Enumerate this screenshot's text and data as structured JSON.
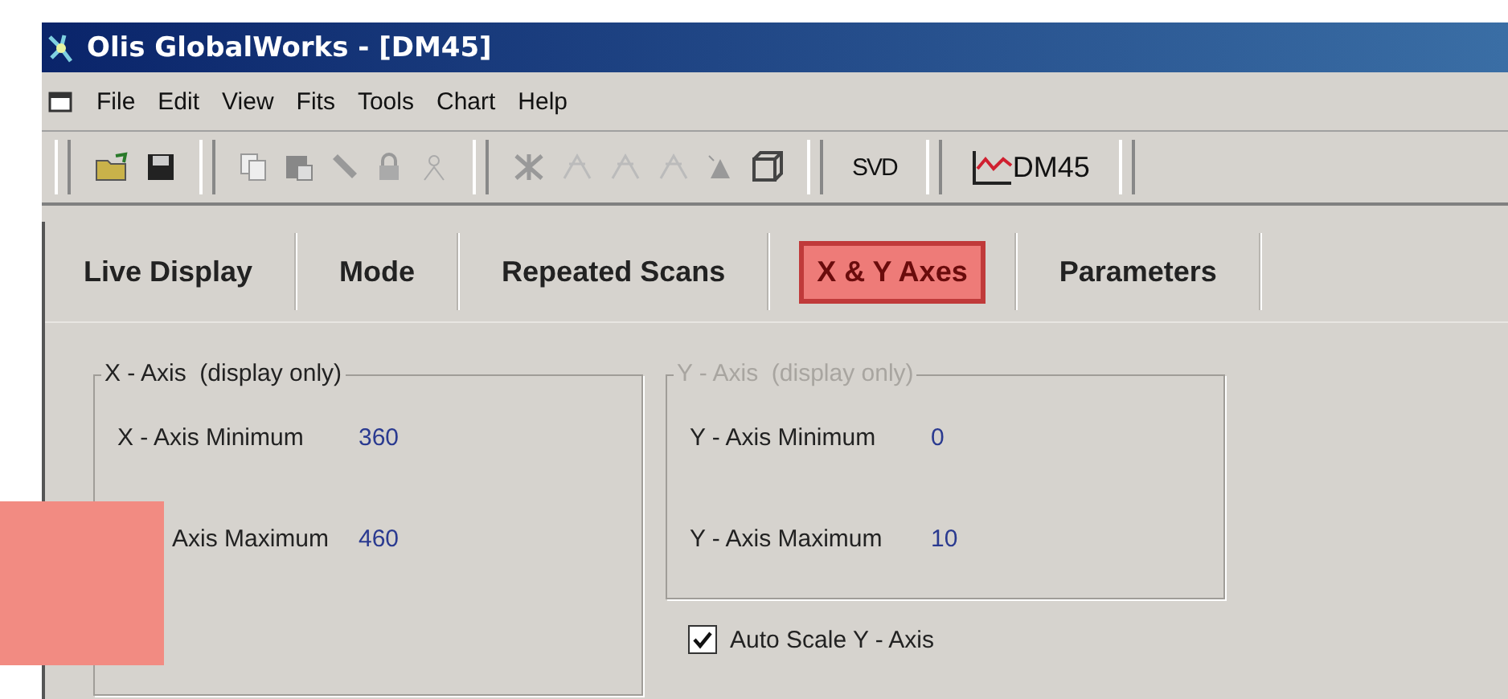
{
  "window": {
    "title": "Olis GlobalWorks - [DM45]"
  },
  "menu": [
    "File",
    "Edit",
    "View",
    "Fits",
    "Tools",
    "Chart",
    "Help"
  ],
  "toolbar": {
    "svd_label": "SVD",
    "chart_label": "DM45"
  },
  "tabs": [
    {
      "label": "Live Display",
      "selected": false
    },
    {
      "label": "Mode",
      "selected": false
    },
    {
      "label": "Repeated Scans",
      "selected": false
    },
    {
      "label": "X & Y Axes",
      "selected": true
    },
    {
      "label": "Parameters",
      "selected": false
    }
  ],
  "groups": [
    {
      "title": "X - Axis  (display only)",
      "disabled": false,
      "rows": [
        {
          "label": "X - Axis Minimum",
          "value": "360"
        },
        {
          "label": "Axis Maximum",
          "value": "460"
        }
      ]
    },
    {
      "title": "Y - Axis  (display only)",
      "disabled": true,
      "rows": [
        {
          "label": "Y - Axis Minimum",
          "value": "0"
        },
        {
          "label": "Y - Axis Maximum",
          "value": "10"
        }
      ]
    }
  ],
  "auto_scale": {
    "label": "Auto Scale Y - Axis",
    "checked": true
  }
}
